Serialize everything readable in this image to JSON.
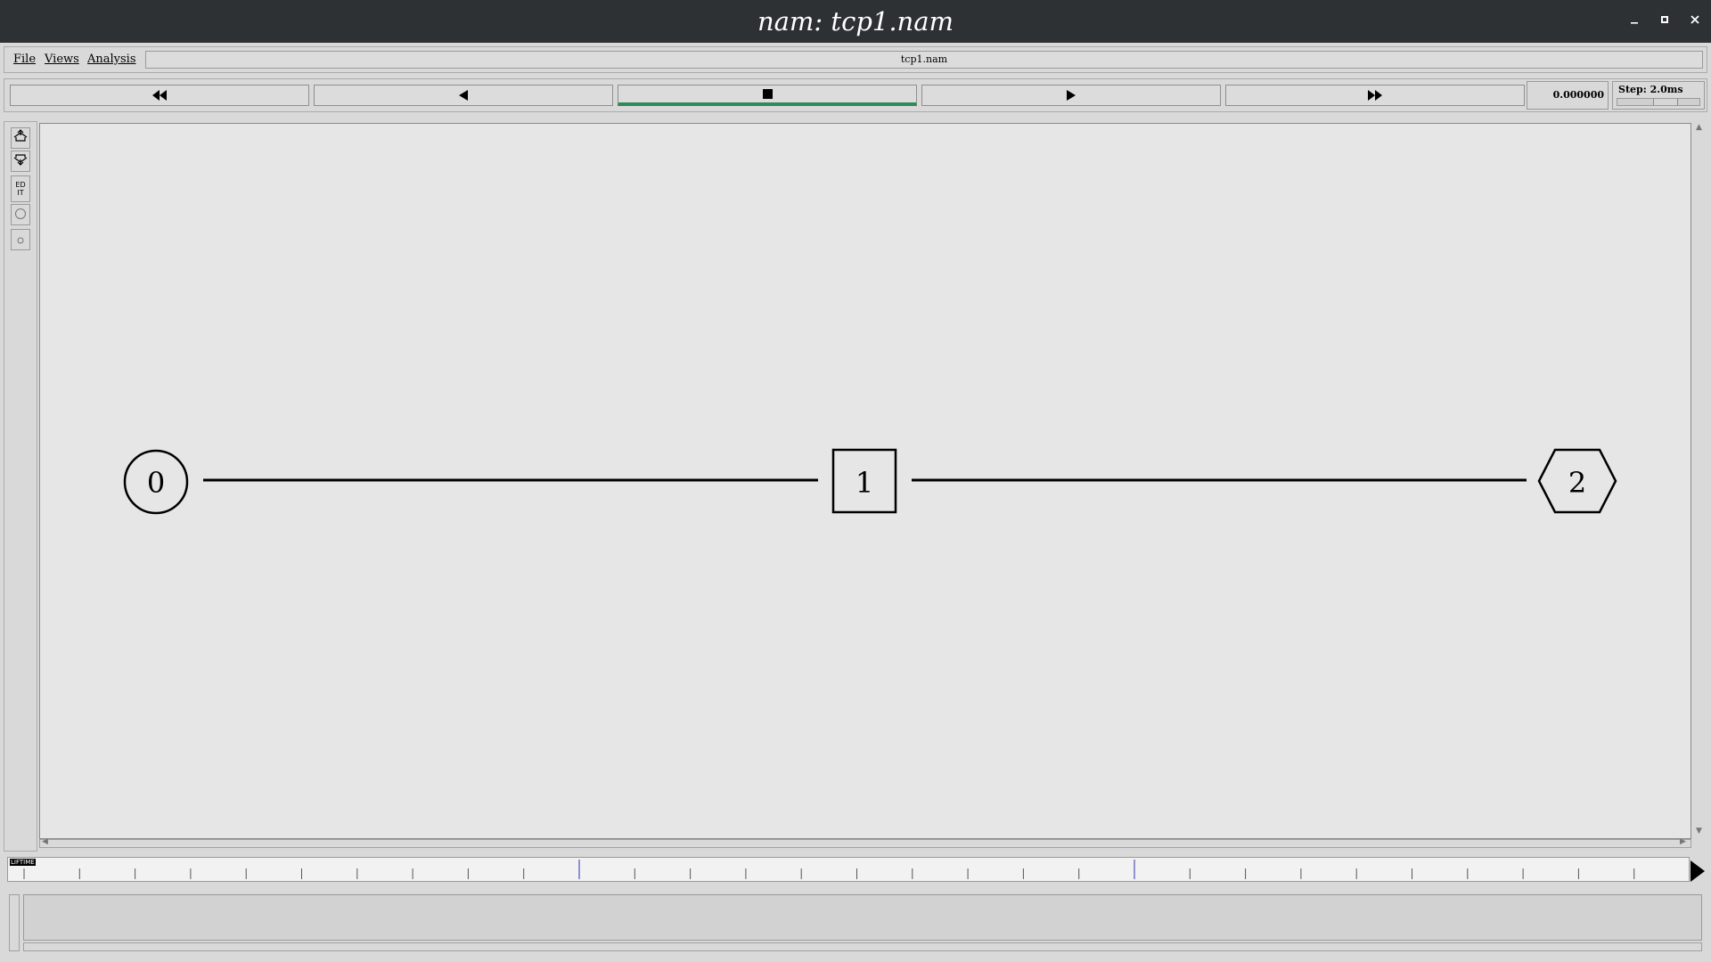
{
  "window": {
    "title": "nam: tcp1.nam",
    "controls": [
      "minimize-icon",
      "maximize-icon",
      "close-icon"
    ]
  },
  "menubar": {
    "file": "File",
    "views": "Views",
    "analysis": "Analysis",
    "filename": "tcp1.nam"
  },
  "toolbar": {
    "buttons": [
      {
        "icon": "fast-rewind-icon"
      },
      {
        "icon": "rewind-icon"
      },
      {
        "icon": "stop-icon",
        "active": true
      },
      {
        "icon": "play-icon"
      },
      {
        "icon": "fast-forward-icon"
      }
    ],
    "time": "0.000000",
    "step_label": "Step: 2.0ms",
    "active_color": "#2e8b57"
  },
  "left_tools": [
    {
      "icon": "zoom-in-icon"
    },
    {
      "icon": "zoom-out-icon"
    },
    {
      "icon": "edit-icon",
      "text": "ED\nIT"
    },
    {
      "icon": "circle-large-icon"
    },
    {
      "icon": "circle-small-icon"
    }
  ],
  "topology": {
    "nodes": [
      {
        "id": "0",
        "shape": "circle"
      },
      {
        "id": "1",
        "shape": "square"
      },
      {
        "id": "2",
        "shape": "hexagon"
      }
    ],
    "links": [
      {
        "from": "0",
        "to": "1"
      },
      {
        "from": "1",
        "to": "2"
      }
    ]
  },
  "timeline": {
    "label": "LIFTIME"
  }
}
